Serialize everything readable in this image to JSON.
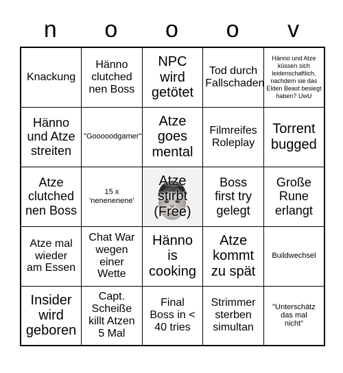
{
  "card": {
    "header_letters": [
      "n",
      "o",
      "o",
      "o",
      "v"
    ],
    "rows": [
      [
        {
          "text": "Knackung",
          "size": "fs-md",
          "free": false
        },
        {
          "text": "Hänno\nclutched\nnen Boss",
          "size": "fs-md",
          "free": false
        },
        {
          "text": "NPC\nwird\ngetötet",
          "size": "fs-xl",
          "free": false
        },
        {
          "text": "Tod durch\nFallschaden",
          "size": "fs-md",
          "free": false
        },
        {
          "text": "Hänno und Atze küssen sich leidenschaftlich, nachdem sie das Elden Beast besiegt haben? UwU",
          "size": "fs-xxs",
          "free": false
        }
      ],
      [
        {
          "text": "Hänno\nund Atze\nstreiten",
          "size": "fs-lg",
          "free": false
        },
        {
          "text": "\"Gooooodgamer\"",
          "size": "fs-xs",
          "free": false
        },
        {
          "text": "Atze\ngoes\nmental",
          "size": "fs-xl",
          "free": false
        },
        {
          "text": "Filmreifes\nRoleplay",
          "size": "fs-md",
          "free": false
        },
        {
          "text": "Torrent\nbugged",
          "size": "fs-xl",
          "free": false
        }
      ],
      [
        {
          "text": "Atze\nclutched\nnen Boss",
          "size": "fs-lg",
          "free": false
        },
        {
          "text": "15 x\n'nenenenene'",
          "size": "fs-xs",
          "free": false
        },
        {
          "text": "Atze\nstirbt\n(Free)",
          "size": "fs-xl",
          "free": true
        },
        {
          "text": "Boss\nfirst try\ngelegt",
          "size": "fs-lg",
          "free": false
        },
        {
          "text": "Große\nRune\nerlangt",
          "size": "fs-lg",
          "free": false
        }
      ],
      [
        {
          "text": "Atze mal\nwieder\nam Essen",
          "size": "fs-md",
          "free": false
        },
        {
          "text": "Chat War\nwegen\neiner\nWette",
          "size": "fs-md",
          "free": false
        },
        {
          "text": "Hänno\nis\ncooking",
          "size": "fs-xl",
          "free": false
        },
        {
          "text": "Atze\nkommt\nzu spät",
          "size": "fs-xl",
          "free": false
        },
        {
          "text": "Buildwechsel",
          "size": "fs-xs",
          "free": false
        }
      ],
      [
        {
          "text": "Insider\nwird\ngeboren",
          "size": "fs-xl",
          "free": false
        },
        {
          "text": "Capt.\nScheiße\nkillt Atzen\n5 Mal",
          "size": "fs-md",
          "free": false
        },
        {
          "text": "Final\nBoss in <\n40 tries",
          "size": "fs-md",
          "free": false
        },
        {
          "text": "Strimmer\nsterben\nsimultan",
          "size": "fs-md",
          "free": false
        },
        {
          "text": "\"Unterschätz\ndas mal\nnicht\"",
          "size": "fs-xs",
          "free": false
        }
      ]
    ],
    "free_cell_image": "atze-face-photo",
    "colors": {
      "grid_line": "#000000",
      "background": "#ffffff",
      "free_cell_background": "#f2f2f2",
      "text": "#000000"
    }
  }
}
